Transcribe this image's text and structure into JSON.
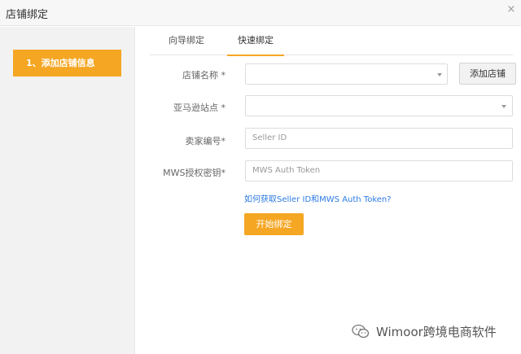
{
  "dialog": {
    "title": "店铺绑定",
    "close_glyph": "×"
  },
  "sidebar": {
    "step_label": "1、添加店铺信息"
  },
  "tabs": [
    {
      "label": "向导绑定",
      "active": false
    },
    {
      "label": "快速绑定",
      "active": true
    }
  ],
  "form": {
    "shop_name_label": "店铺名称 *",
    "shop_name_value": "",
    "site_label": "亚马逊站点 *",
    "site_value": "",
    "seller_id_label": "卖家编号*",
    "seller_id_placeholder": "Seller ID",
    "token_label": "MWS授权密钥*",
    "token_placeholder": "MWS Auth Token",
    "add_shop_button": "添加店铺",
    "help_link": "如何获取Seller ID和MWS Auth Token?",
    "start_button": "开始绑定"
  },
  "watermark": {
    "text": "Wimoor跨境电商软件",
    "icon": "wechat-icon"
  },
  "colors": {
    "accent": "#f5a623",
    "link": "#2c7be5",
    "sidebar_bg": "#f2f2f2"
  }
}
